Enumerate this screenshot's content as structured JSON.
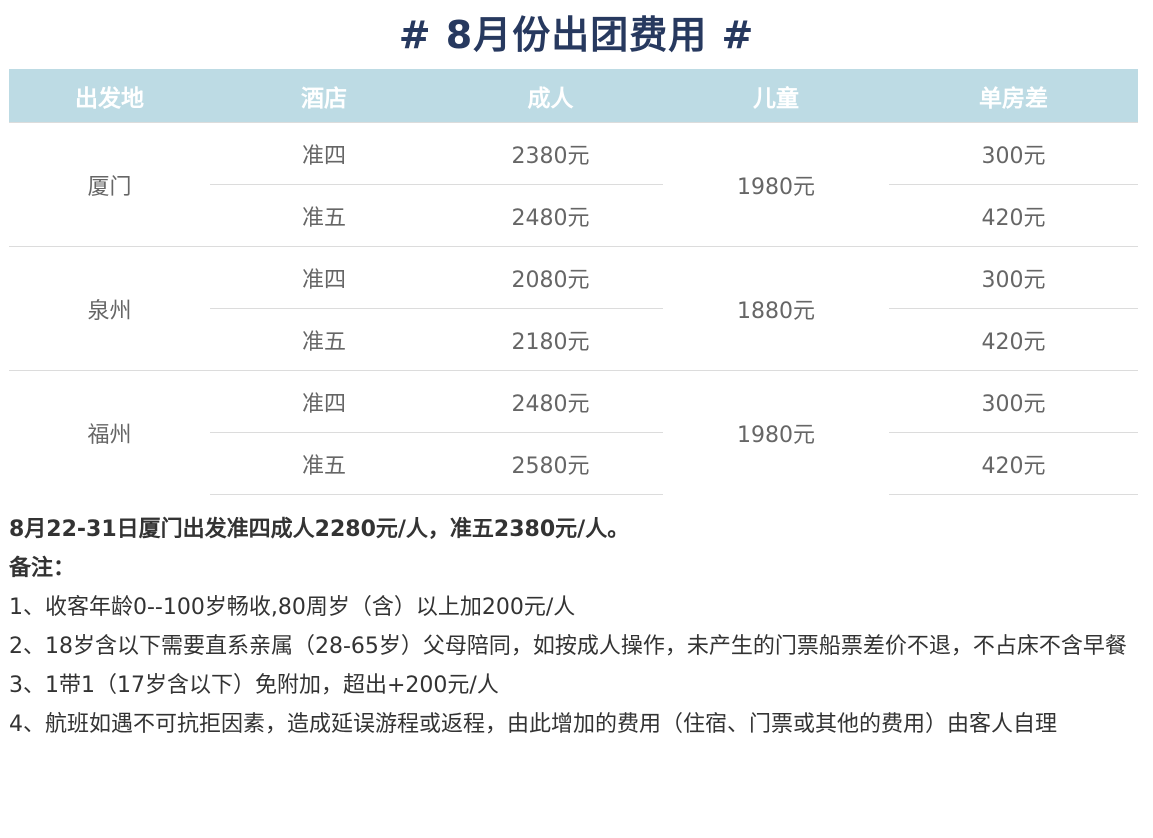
{
  "title": "# 8月份出团费用 #",
  "table": {
    "headers": [
      "出发地",
      "酒店",
      "成人",
      "儿童",
      "单房差"
    ],
    "groups": [
      {
        "city": "厦门",
        "child": "1980元",
        "rows": [
          {
            "hotel": "准四",
            "adult": "2380元",
            "single": "300元"
          },
          {
            "hotel": "准五",
            "adult": "2480元",
            "single": "420元"
          }
        ]
      },
      {
        "city": "泉州",
        "child": "1880元",
        "rows": [
          {
            "hotel": "准四",
            "adult": "2080元",
            "single": "300元"
          },
          {
            "hotel": "准五",
            "adult": "2180元",
            "single": "420元"
          }
        ]
      },
      {
        "city": "福州",
        "child": "1980元",
        "rows": [
          {
            "hotel": "准四",
            "adult": "2480元",
            "single": "300元"
          },
          {
            "hotel": "准五",
            "adult": "2580元",
            "single": "420元"
          }
        ]
      }
    ]
  },
  "notes": {
    "highlight": "8月22-31日厦门出发准四成人2280元/人，准五2380元/人。",
    "remark_label": "备注：",
    "items": [
      "1、收客年龄0--100岁畅收,80周岁（含）以上加200元/人",
      "2、18岁含以下需要直系亲属（28-65岁）父母陪同，如按成人操作，未产生的门票船票差价不退，不占床不含早餐",
      "3、1带1（17岁含以下）免附加，超出+200元/人",
      "4、航班如遇不可抗拒因素，造成延误游程或返程，由此增加的费用（住宿、门票或其他的费用）由客人自理"
    ]
  }
}
